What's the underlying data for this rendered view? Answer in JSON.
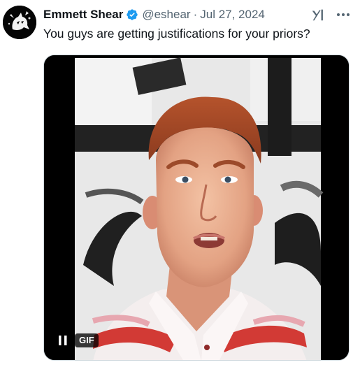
{
  "tweet": {
    "author": {
      "display_name": "Emmett Shear",
      "handle": "@eshear",
      "avatar_icon": "cat-avatar-icon",
      "verified": true,
      "verified_color": "#1d9bf0"
    },
    "separator": "·",
    "date": "Jul 27, 2024",
    "text": "You guys are getting justifications for your priors?",
    "media": {
      "type": "gif",
      "badge": "GIF",
      "playing": true
    },
    "actions": {
      "grok_icon": "grok-icon",
      "more_icon": "more-options-icon"
    }
  }
}
